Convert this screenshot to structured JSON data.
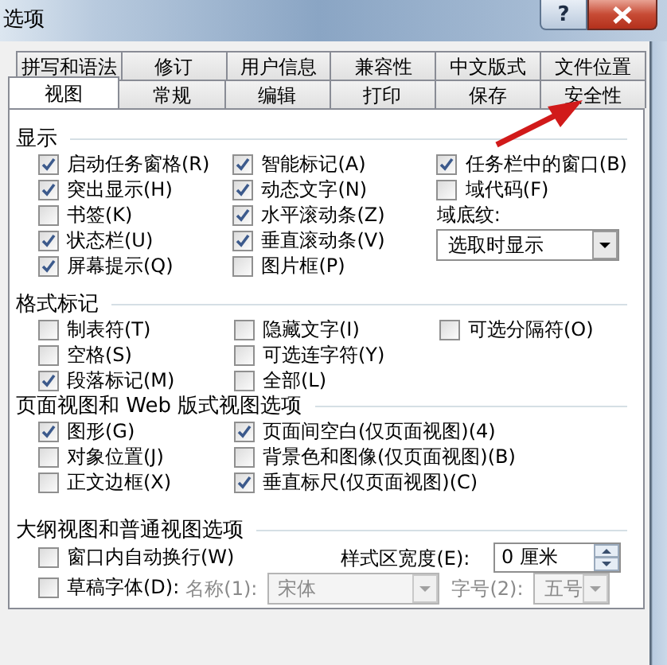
{
  "window": {
    "title": "选项",
    "help_button": "?"
  },
  "tab_rows": [
    {
      "tabs": [
        {
          "label": "拼写和语法",
          "selected": false
        },
        {
          "label": "修订",
          "selected": false
        },
        {
          "label": "用户信息",
          "selected": false
        },
        {
          "label": "兼容性",
          "selected": false
        },
        {
          "label": "中文版式",
          "selected": false
        },
        {
          "label": "文件位置",
          "selected": false
        }
      ]
    },
    {
      "tabs": [
        {
          "label": "视图",
          "selected": true
        },
        {
          "label": "常规",
          "selected": false
        },
        {
          "label": "编辑",
          "selected": false
        },
        {
          "label": "打印",
          "selected": false
        },
        {
          "label": "保存",
          "selected": false
        },
        {
          "label": "安全性",
          "selected": false
        }
      ]
    }
  ],
  "sections": [
    {
      "title": "显示",
      "kind": "grid",
      "columns": [
        [
          {
            "kind": "checkbox",
            "label": "启动任务窗格(R)",
            "checked": true
          },
          {
            "kind": "checkbox",
            "label": "突出显示(H)",
            "checked": true
          },
          {
            "kind": "checkbox",
            "label": "书签(K)",
            "checked": false
          },
          {
            "kind": "checkbox",
            "label": "状态栏(U)",
            "checked": true
          },
          {
            "kind": "checkbox",
            "label": "屏幕提示(Q)",
            "checked": true
          }
        ],
        [
          {
            "kind": "checkbox",
            "label": "智能标记(A)",
            "checked": true
          },
          {
            "kind": "checkbox",
            "label": "动态文字(N)",
            "checked": true
          },
          {
            "kind": "checkbox",
            "label": "水平滚动条(Z)",
            "checked": true
          },
          {
            "kind": "checkbox",
            "label": "垂直滚动条(V)",
            "checked": true
          },
          {
            "kind": "checkbox",
            "label": "图片框(P)",
            "checked": false
          }
        ],
        [
          {
            "kind": "checkbox",
            "label": "任务栏中的窗口(B)",
            "checked": true
          },
          {
            "kind": "checkbox",
            "label": "域代码(F)",
            "checked": false
          },
          {
            "kind": "label",
            "text": "域底纹:",
            "disabled": false
          },
          {
            "kind": "select",
            "value": "选取时显示",
            "disabled": false
          }
        ]
      ]
    },
    {
      "title": "格式标记",
      "kind": "grid",
      "columns": [
        [
          {
            "kind": "checkbox",
            "label": "制表符(T)",
            "checked": false
          },
          {
            "kind": "checkbox",
            "label": "空格(S)",
            "checked": false
          },
          {
            "kind": "checkbox",
            "label": "段落标记(M)",
            "checked": true
          }
        ],
        [
          {
            "kind": "checkbox",
            "label": "隐藏文字(I)",
            "checked": false
          },
          {
            "kind": "checkbox",
            "label": "可选连字符(Y)",
            "checked": false
          },
          {
            "kind": "checkbox",
            "label": "全部(L)",
            "checked": false
          }
        ],
        [
          {
            "kind": "checkbox",
            "label": "可选分隔符(O)",
            "checked": false
          }
        ]
      ]
    },
    {
      "title": "页面视图和 Web 版式视图选项",
      "kind": "grid",
      "columns": [
        [
          {
            "kind": "checkbox",
            "label": "图形(G)",
            "checked": true
          },
          {
            "kind": "checkbox",
            "label": "对象位置(J)",
            "checked": false
          },
          {
            "kind": "checkbox",
            "label": "正文边框(X)",
            "checked": false
          }
        ],
        [
          {
            "kind": "checkbox",
            "label": "页面间空白(仅页面视图)(4)",
            "checked": true
          },
          {
            "kind": "checkbox",
            "label": "背景色和图像(仅页面视图)(B)",
            "checked": false
          },
          {
            "kind": "checkbox",
            "label": "垂直标尺(仅页面视图)(C)",
            "checked": true
          }
        ]
      ]
    },
    {
      "title": "大纲视图和普通视图选项",
      "kind": "rows",
      "rows": [
        {
          "items": [
            {
              "kind": "checkbox",
              "label": "窗口内自动换行(W)",
              "checked": false
            },
            {
              "kind": "label",
              "text": "样式区宽度(E):",
              "disabled": false
            },
            {
              "kind": "spin",
              "value": "0 厘米"
            }
          ]
        },
        {
          "items": [
            {
              "kind": "checkbox",
              "label": "草稿字体(D):",
              "checked": false
            },
            {
              "kind": "label",
              "text": "名称(1):",
              "disabled": true
            },
            {
              "kind": "select",
              "value": "宋体",
              "disabled": true
            },
            {
              "kind": "label",
              "text": "字号(2):",
              "disabled": true
            },
            {
              "kind": "select",
              "value": "五号",
              "disabled": true
            }
          ]
        }
      ]
    }
  ]
}
